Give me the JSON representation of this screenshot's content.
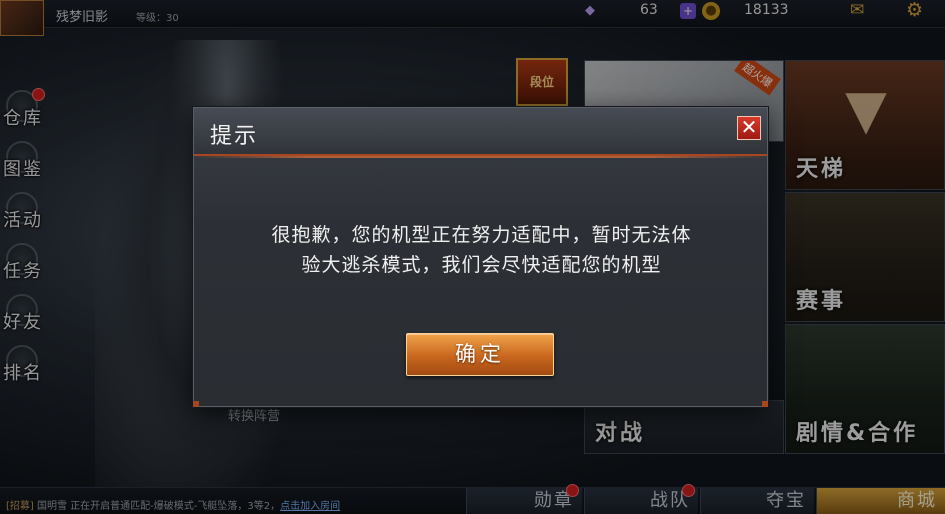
{
  "topbar": {
    "player_name": "残梦旧影",
    "player_level": "等级：30",
    "gem_count": "63",
    "gold_count": "18133"
  },
  "left_menu": [
    {
      "label": "仓库",
      "icon": "warehouse-icon",
      "has_dot": true
    },
    {
      "label": "图鉴",
      "icon": "codex-icon",
      "has_dot": false
    },
    {
      "label": "活动",
      "icon": "event-icon",
      "has_dot": false
    },
    {
      "label": "任务",
      "icon": "task-icon",
      "has_dot": false
    },
    {
      "label": "好友",
      "icon": "friends-icon",
      "has_dot": false
    },
    {
      "label": "排名",
      "icon": "ranking-icon",
      "has_dot": false
    }
  ],
  "tiles": {
    "feature_badge": "超火爆",
    "ladder": "天梯",
    "match": "赛事",
    "story": "剧情&合作",
    "battle": "对战",
    "rank_emblem": "段位"
  },
  "switch_camp": "转换阵营",
  "chat": {
    "channel": "[招募]",
    "sender": "国明雪",
    "message": "正在开启普通匹配-爆破模式-飞艇坠落，3等2，",
    "link": "点击加入房间"
  },
  "bottom_buttons": {
    "medal": "勋章",
    "team": "战队",
    "treasure": "夺宝",
    "shop": "商城"
  },
  "dialog": {
    "title": "提示",
    "message_line1": "很抱歉，您的机型正在努力适配中，暂时无法体",
    "message_line2": "验大逃杀模式，我们会尽快适配您的机型",
    "confirm_label": "确定",
    "close_glyph": "✕"
  },
  "colors": {
    "accent_orange": "#c8661e",
    "close_red": "#d83a2a",
    "notification_red": "#d11f1f"
  }
}
